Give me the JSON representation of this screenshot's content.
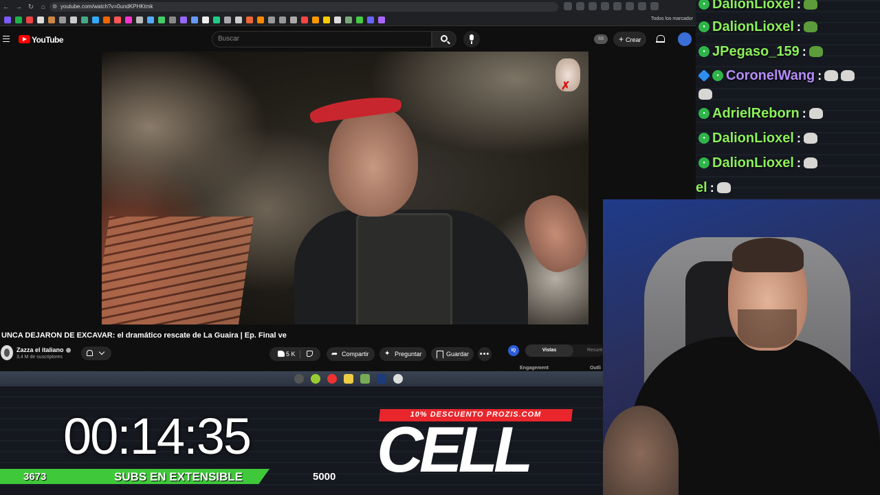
{
  "browser": {
    "url": "youtube.com/watch?v=0undKPHKtmk",
    "all_bookmarks_label": "Todos los marcador"
  },
  "youtube": {
    "logo_text": "YouTube",
    "search_placeholder": "Buscar",
    "ss_badge": "SS",
    "create_label": "Crear"
  },
  "video": {
    "title": "UNCA DEJARON DE EXCAVAR: el dramático rescate de La Guaira | Ep. Final ve",
    "channel_name": "Zazza el italiano",
    "subscribers": "3,4 M de suscriptores",
    "likes": "5 K",
    "share_label": "Compartir",
    "ask_label": "Preguntar",
    "save_label": "Guardar"
  },
  "side_panel": {
    "tab_active": "Vistas",
    "tab_other": "Resum",
    "label_engagement": "Engagement",
    "label_outline": "Outli"
  },
  "overlay": {
    "timer": "00:14:35",
    "subs_current": "3673",
    "subs_label": "SUBS EN EXTENSIBLE",
    "subs_goal": "5000",
    "subs_progress": 0.7346,
    "promo_text": "10% DESCUENTO PROZIS.COM",
    "promo_brand": "CELL"
  },
  "chat": {
    "messages": [
      {
        "user": "DalionLioxel",
        "emote": "frog-emote"
      },
      {
        "user": "DalionLioxel",
        "emote": "frog-emote"
      },
      {
        "user": "JPegaso_159",
        "emote": "frog-emote"
      },
      {
        "user": "CoronelWang",
        "emote": "cat-emote"
      },
      {
        "user": "AdrielReborn",
        "emote": "cat-emote"
      },
      {
        "user": "DalionLioxel",
        "emote": "cat-emote"
      },
      {
        "user": "DalionLioxel",
        "emote": "cat-emote"
      },
      {
        "user": "el",
        "emote": "cat-emote"
      }
    ]
  },
  "colors": {
    "youtube_red": "#ff0000",
    "subs_bar_green": "#3fc93a",
    "promo_red": "#e8262c",
    "chat_name_green": "#8cf05a",
    "chat_name_purple": "#b38cf7"
  }
}
